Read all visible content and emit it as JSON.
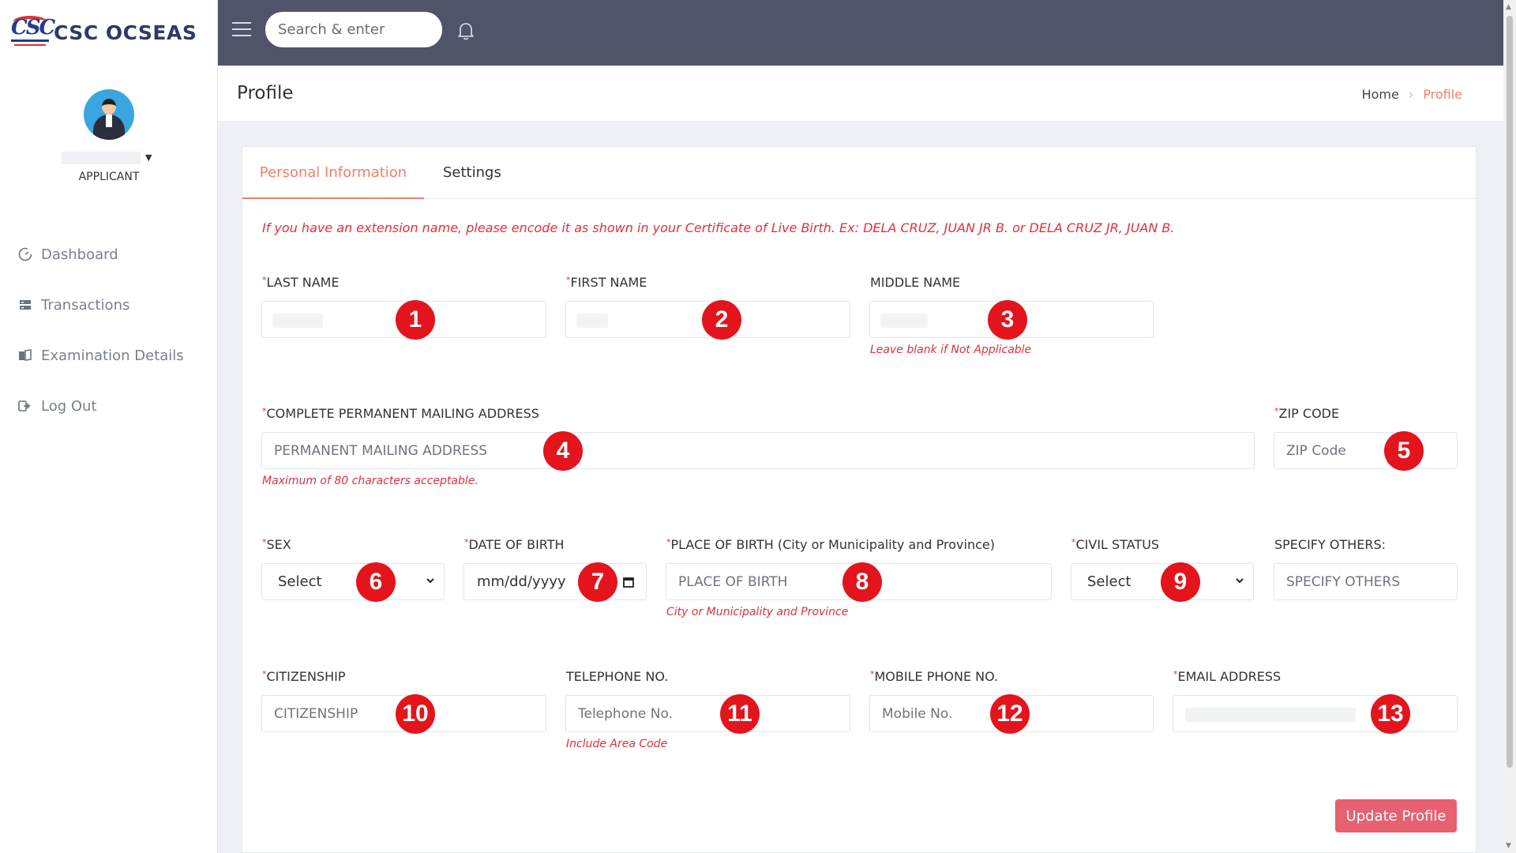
{
  "brand": {
    "name": "CSC OCSEAS"
  },
  "user": {
    "role": "APPLICANT"
  },
  "nav": [
    {
      "label": "Dashboard",
      "icon": "dashboard-icon"
    },
    {
      "label": "Transactions",
      "icon": "transactions-icon"
    },
    {
      "label": "Examination Details",
      "icon": "book-icon"
    },
    {
      "label": "Log Out",
      "icon": "logout-icon"
    }
  ],
  "topbar": {
    "search_placeholder": "Search & enter"
  },
  "page": {
    "title": "Profile",
    "breadcrumb": {
      "home": "Home",
      "current": "Profile"
    }
  },
  "tabs": {
    "personal": "Personal Information",
    "settings": "Settings"
  },
  "form": {
    "note": "If you have an extension name, please encode it as shown in your Certificate of Live Birth. Ex: DELA CRUZ, JUAN JR B. or DELA CRUZ JR, JUAN B.",
    "required_mark": "*",
    "last_name": {
      "label": "LAST NAME",
      "badge": "1"
    },
    "first_name": {
      "label": "FIRST NAME",
      "badge": "2"
    },
    "middle_name": {
      "label": "MIDDLE NAME",
      "help": "Leave blank if Not Applicable",
      "badge": "3"
    },
    "address": {
      "label": "COMPLETE PERMANENT MAILING ADDRESS",
      "placeholder": "PERMANENT MAILING ADDRESS",
      "help": "Maximum of 80 characters acceptable.",
      "badge": "4"
    },
    "zip": {
      "label": "ZIP CODE",
      "placeholder": "ZIP Code",
      "badge": "5"
    },
    "sex": {
      "label": "SEX",
      "value": "Select",
      "badge": "6"
    },
    "dob": {
      "label": "DATE OF BIRTH",
      "value": "mm/dd/yyyy",
      "badge": "7"
    },
    "pob": {
      "label": "PLACE OF BIRTH (City or Municipality and Province)",
      "placeholder": "PLACE OF BIRTH",
      "help": "City or Municipality and Province",
      "badge": "8"
    },
    "civil": {
      "label": "CIVIL STATUS",
      "value": "Select",
      "badge": "9"
    },
    "others": {
      "label": "SPECIFY OTHERS:",
      "placeholder": "SPECIFY OTHERS"
    },
    "citizenship": {
      "label": "CITIZENSHIP",
      "placeholder": "CITIZENSHIP",
      "badge": "10"
    },
    "telephone": {
      "label": "TELEPHONE NO.",
      "placeholder": "Telephone No.",
      "help": "Include Area Code",
      "badge": "11"
    },
    "mobile": {
      "label": "MOBILE PHONE NO.",
      "placeholder": "Mobile No.",
      "badge": "12"
    },
    "email": {
      "label": "EMAIL ADDRESS",
      "badge": "13"
    },
    "submit": "Update Profile"
  },
  "colors": {
    "accent": "#f0806a",
    "error": "#e0303a",
    "topbar": "#4f5469",
    "button": "#e86170",
    "badge": "#e3141b"
  }
}
